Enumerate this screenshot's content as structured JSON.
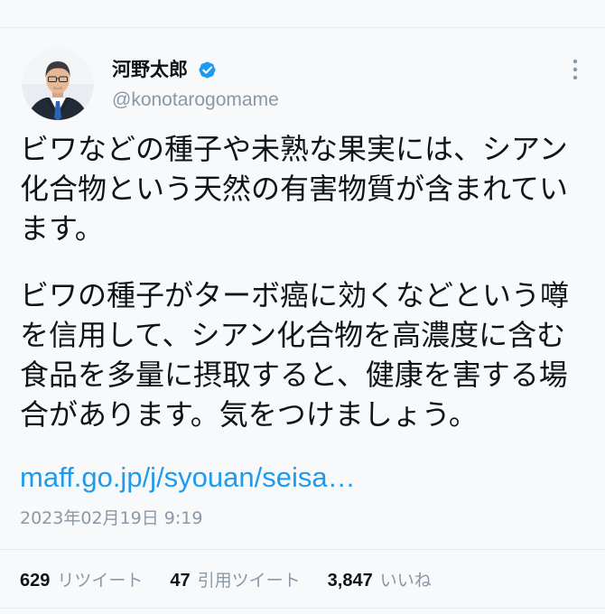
{
  "tweet": {
    "author": {
      "name": "河野太郎",
      "handle": "@konotarogomame",
      "verified": true,
      "verified_icon": "verified-badge-icon",
      "avatar_icon": "avatar"
    },
    "more_icon": "more-options-icon",
    "paragraphs": [
      "ビワなどの種子や未熟な果実には、シアン化合物という天然の有害物質が含まれています。",
      "ビワの種子がターボ癌に効くなどという噂を信用して、シアン化合物を高濃度に含む食品を多量に摂取すると、健康を害する場合があります。気をつけましょう。"
    ],
    "link": "maff.go.jp/j/syouan/seisa…",
    "timestamp": "2023年02月19日 9:19",
    "stats": {
      "retweets": {
        "count": "629",
        "label": "リツイート"
      },
      "quotes": {
        "count": "47",
        "label": "引用ツイート"
      },
      "likes": {
        "count": "3,847",
        "label": "いいね"
      }
    }
  },
  "colors": {
    "text": "#0f1419",
    "secondary": "#8b98a5",
    "link": "#1d9bf0",
    "verified": "#1d9bf0",
    "divider": "#e6ecf0",
    "background": "#f7f9fa"
  }
}
